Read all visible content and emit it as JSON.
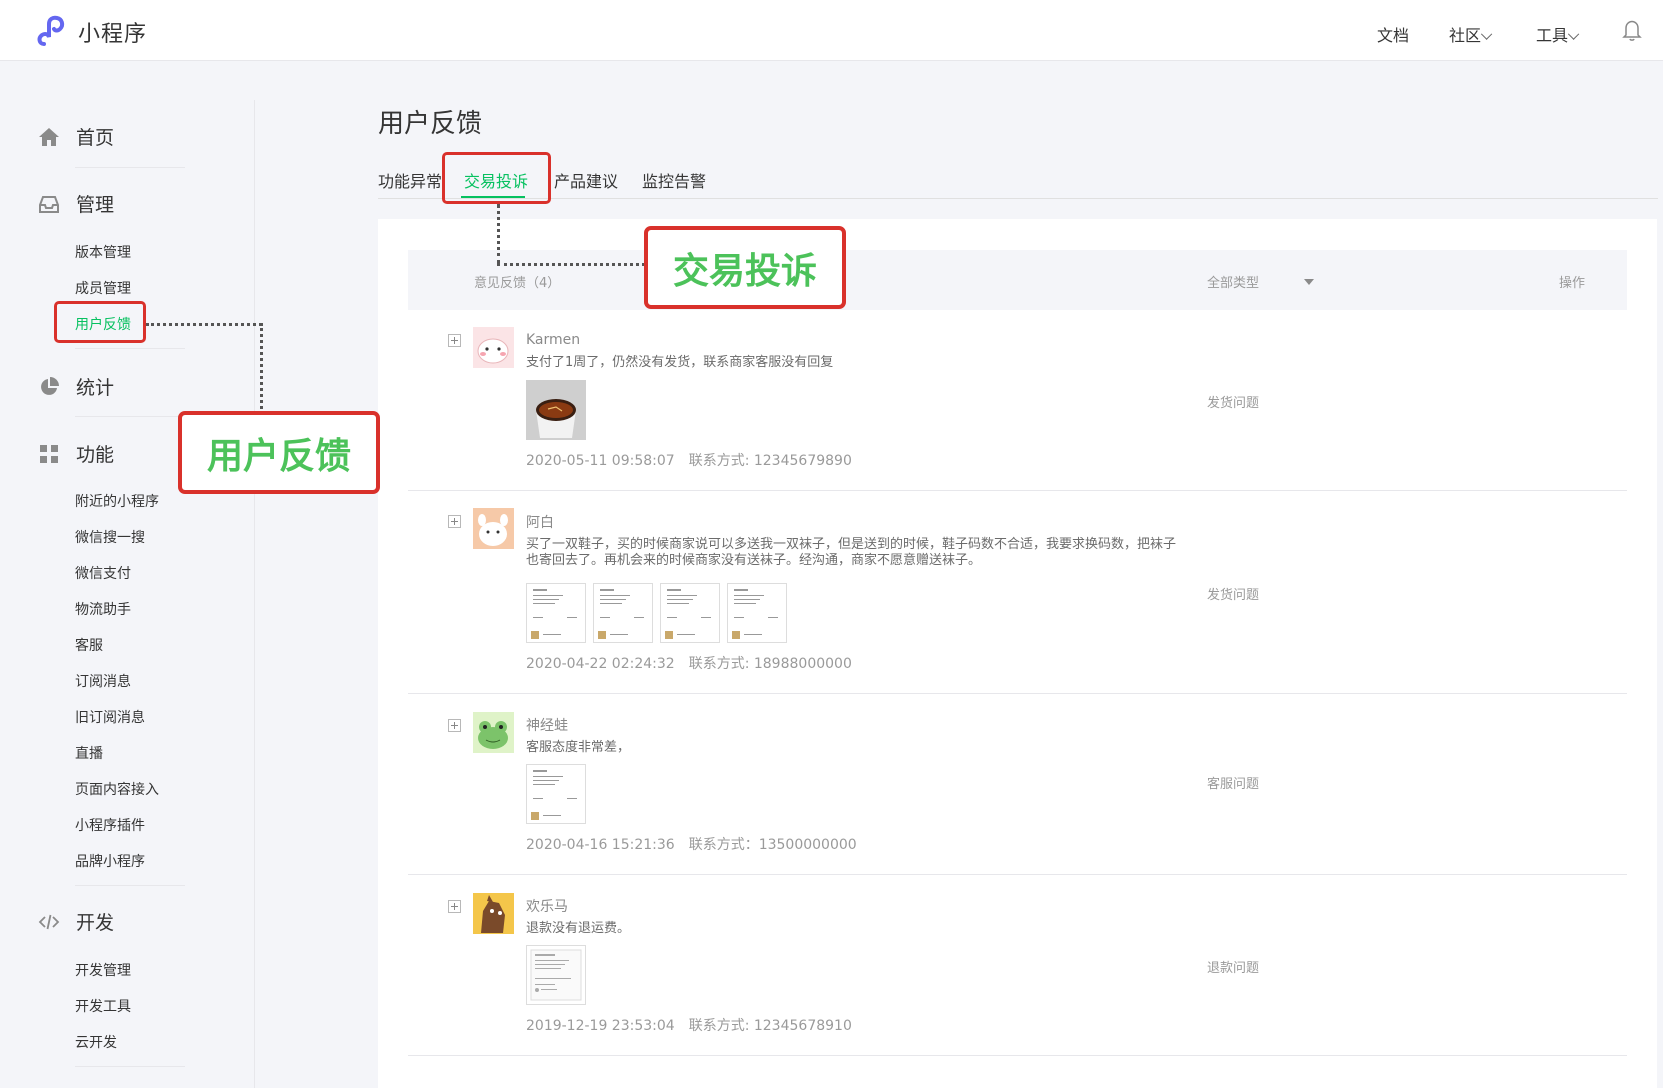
{
  "app": {
    "title": "小程序",
    "accent": "#07c160",
    "callout_color": "#d9312b"
  },
  "topnav": {
    "docs": "文档",
    "community": "社区",
    "tools": "工具"
  },
  "sidebar": {
    "home": "首页",
    "manage": {
      "label": "管理",
      "items": [
        "版本管理",
        "成员管理",
        "用户反馈"
      ]
    },
    "stats": "统计",
    "features": {
      "label": "功能",
      "items": [
        "附近的小程序",
        "微信搜一搜",
        "微信支付",
        "物流助手",
        "客服",
        "订阅消息",
        "旧订阅消息",
        "直播",
        "页面内容接入",
        "小程序插件",
        "品牌小程序"
      ]
    },
    "dev": {
      "label": "开发",
      "items": [
        "开发管理",
        "开发工具",
        "云开发"
      ]
    }
  },
  "page": {
    "title": "用户反馈"
  },
  "tabs": {
    "t1": "功能异常",
    "t2": "交易投诉",
    "t3": "产品建议",
    "t4": "监控告警",
    "active": "交易投诉"
  },
  "table": {
    "header_feedback": "意见反馈（4）",
    "header_type": "全部类型",
    "header_action": "操作"
  },
  "feedback": [
    {
      "user": "Karmen",
      "content": "支付了1周了，仍然没有发货，联系商家客服没有回复",
      "time": "2020-05-11 09:58:07",
      "contact": "联系方式: 12345679890",
      "type": "发货问题"
    },
    {
      "user": "阿白",
      "content": "买了一双鞋子，买的时候商家说可以多送我一双袜子，但是送到的时候，鞋子码数不合适，我要求换码数，把袜子也寄回去了。再机会来的时候商家没有送袜子。经沟通，商家不愿意赠送袜子。",
      "time": "2020-04-22 02:24:32",
      "contact": "联系方式: 18988000000",
      "type": "发货问题"
    },
    {
      "user": "神经蛙",
      "content": "客服态度非常差，",
      "time": "2020-04-16 15:21:36",
      "contact": "联系方式：13500000000",
      "type": "客服问题"
    },
    {
      "user": "欢乐马",
      "content": "退款没有退运费。",
      "time": "2019-12-19 23:53:04",
      "contact": "联系方式: 12345678910",
      "type": "退款问题"
    }
  ],
  "callouts": {
    "sidebar_label": "用户反馈",
    "tab_label": "交易投诉"
  }
}
